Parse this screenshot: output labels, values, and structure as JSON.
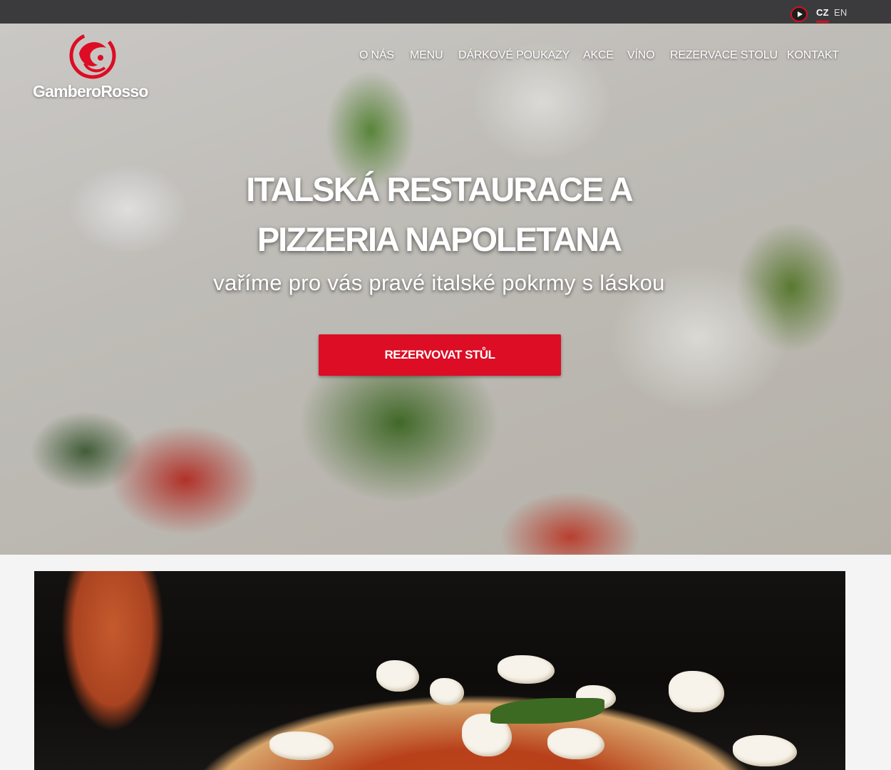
{
  "top_bar": {
    "languages": [
      {
        "code": "CZ",
        "active": true
      },
      {
        "code": "EN",
        "active": false
      }
    ],
    "video_icon": "play-circle-icon"
  },
  "header": {
    "logo_text": "GamberoRosso",
    "nav": [
      "O NÁS",
      "MENU",
      "DÁRKOVÉ POUKAZY",
      "AKCE",
      "VÍNO",
      "REZERVACE STOLU",
      "KONTAKT"
    ]
  },
  "hero": {
    "headline_line1": "ITALSKÁ RESTAURACE A",
    "headline_line2": "PIZZERIA NAPOLETANA",
    "subheadline": "vaříme pro vás pravé italské pokrmy s láskou",
    "cta_label": "REZERVOVAT STŮL"
  },
  "colors": {
    "accent": "#dc0d24",
    "top_bar": "#3b3b3d",
    "page_bg": "#f4f4f4"
  }
}
